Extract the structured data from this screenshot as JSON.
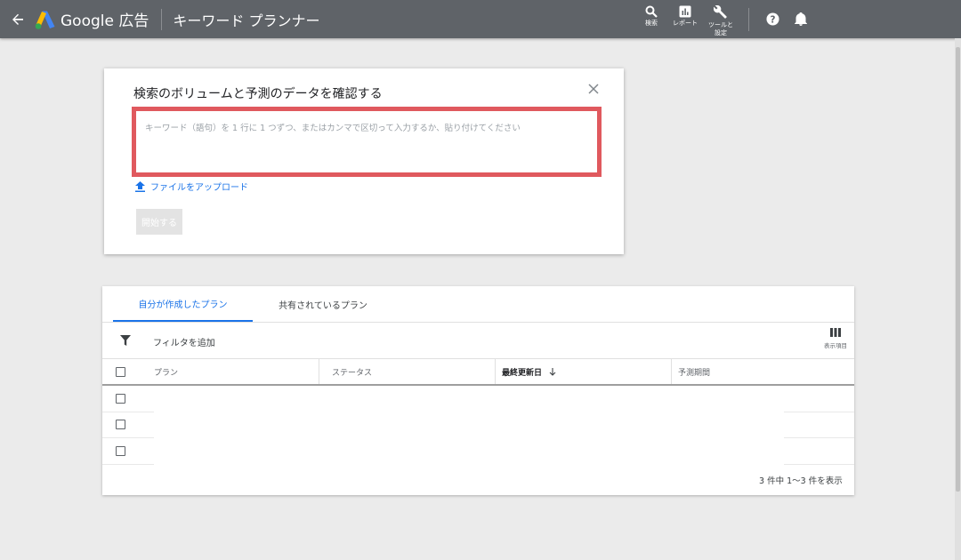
{
  "header": {
    "brand": "Google 広告",
    "title": "キーワード プランナー",
    "tools": [
      {
        "label": "検索",
        "icon": "search-icon"
      },
      {
        "label": "レポート",
        "icon": "report-icon"
      },
      {
        "label": "ツールと\n設定",
        "icon": "wrench-icon"
      }
    ],
    "help_icon": "help-icon",
    "bell_icon": "bell-icon"
  },
  "dialog": {
    "title": "検索のボリュームと予測のデータを確認する",
    "input_placeholder": "キーワード（語句）を 1 行に 1 つずつ、またはカンマで区切って入力するか、貼り付けてください",
    "upload_label": "ファイルをアップロード",
    "start_label": "開始する",
    "highlight_color": "#e0595e"
  },
  "plans": {
    "tabs": [
      {
        "label": "自分が作成したプラン",
        "active": true
      },
      {
        "label": "共有されているプラン",
        "active": false
      }
    ],
    "filter_label": "フィルタを追加",
    "columns_label": "表示項目",
    "headers": {
      "plan": "プラン",
      "status": "ステータス",
      "updated": "最終更新日",
      "period": "予測期間"
    },
    "row_count": 3,
    "pagination": "3 件中 1～3 件を表示"
  },
  "colors": {
    "header_bg": "#5f6368",
    "accent": "#1a73e8",
    "page_bg": "#ebebeb"
  }
}
